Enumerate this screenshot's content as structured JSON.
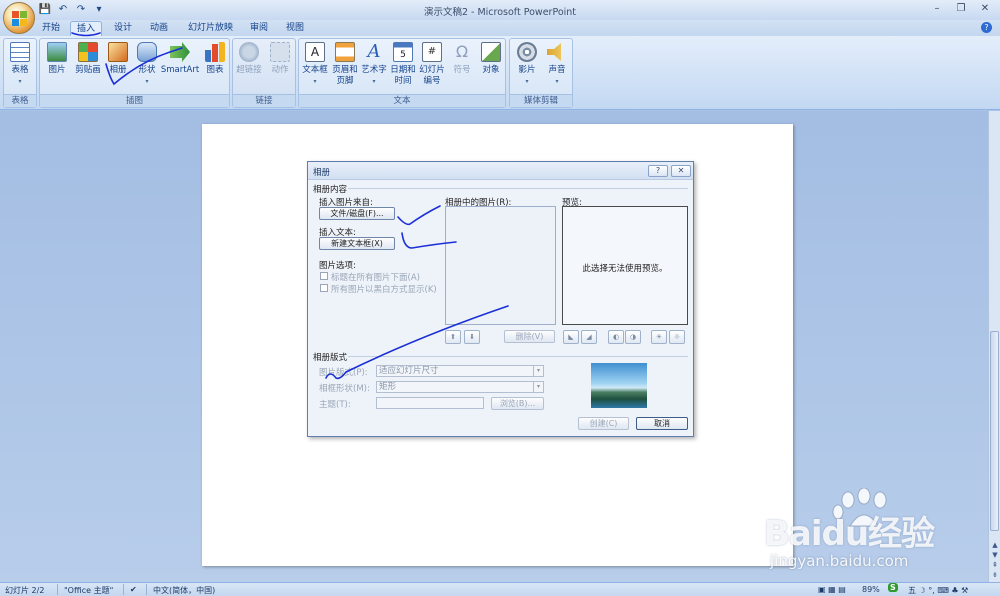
{
  "window": {
    "title": "演示文稿2 - Microsoft PowerPoint"
  },
  "tabs": [
    {
      "label": "开始"
    },
    {
      "label": "插入"
    },
    {
      "label": "设计"
    },
    {
      "label": "动画"
    },
    {
      "label": "幻灯片放映"
    },
    {
      "label": "审阅"
    },
    {
      "label": "视图"
    }
  ],
  "active_tab": "插入",
  "ribbon": {
    "groups": [
      {
        "label": "表格",
        "buttons": [
          "表格"
        ]
      },
      {
        "label": "插图",
        "buttons": [
          "图片",
          "剪贴画",
          "相册",
          "形状",
          "SmartArt",
          "图表"
        ]
      },
      {
        "label": "链接",
        "buttons": [
          "超链接",
          "动作"
        ]
      },
      {
        "label": "文本",
        "buttons": [
          "文本框",
          "页眉和\n页脚",
          "艺术字",
          "日期和\n时间",
          "幻灯片\n编号",
          "符号",
          "对象"
        ]
      },
      {
        "label": "媒体剪辑",
        "buttons": [
          "影片",
          "声音"
        ]
      }
    ]
  },
  "dialog": {
    "title": "相册",
    "section_content": "相册内容",
    "insert_from": "插入图片来自:",
    "file_disk_btn": "文件/磁盘(F)...",
    "insert_text": "插入文本:",
    "new_textbox_btn": "新建文本框(X)",
    "picture_options": "图片选项:",
    "option1": "标题在所有图片下面(A)",
    "option2": "所有图片以黑白方式显示(K)",
    "pictures_in_album": "相册中的图片(R):",
    "preview_label": "预览:",
    "preview_text": "此选择无法使用预览。",
    "remove_btn": "删除(V)",
    "section_layout": "相册版式",
    "picture_layout_label": "图片版式(P):",
    "picture_layout_value": "适应幻灯片尺寸",
    "frame_shape_label": "相框形状(M):",
    "frame_shape_value": "矩形",
    "theme_label": "主题(T):",
    "browse_btn": "浏览(B)...",
    "create_btn": "创建(C)",
    "cancel_btn": "取消"
  },
  "statusbar": {
    "slide": "幻灯片 2/2",
    "theme": "\"Office 主题\"",
    "language": "中文(简体，中国)",
    "zoom": "89%"
  },
  "watermark": {
    "brand": "Baidu经验",
    "url": "jingyan.baidu.com"
  },
  "colors": {
    "accent": "#15428b",
    "ribbon": "#cddff5",
    "workspace": "#abc4e6",
    "ink": "#1a2fd6"
  }
}
